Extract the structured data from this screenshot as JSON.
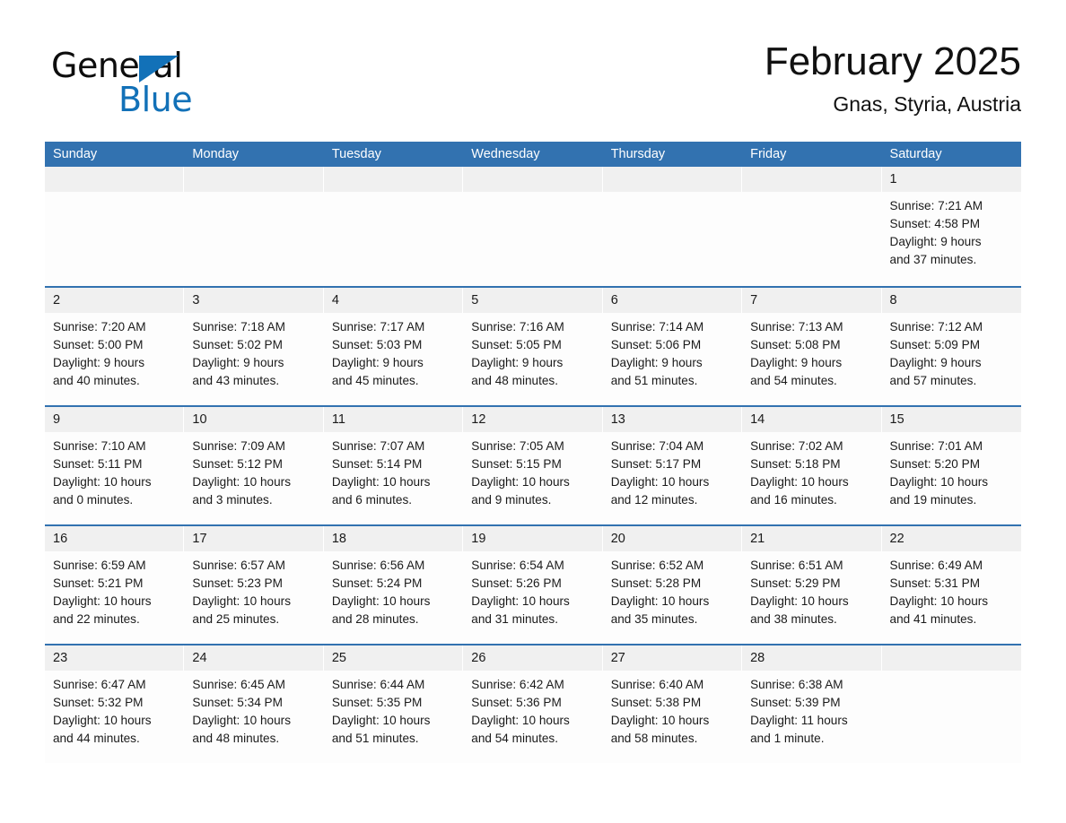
{
  "logo": {
    "word_one": "General",
    "word_two": "Blue",
    "triangle_icon": "blue-triangle-icon",
    "accent_color": "#1271b8"
  },
  "header": {
    "month_title": "February 2025",
    "location": "Gnas, Styria, Austria"
  },
  "colors": {
    "header_blue": "#3272b0",
    "daynum_gray": "#f0f0f0",
    "cell_white": "#fdfdfd",
    "text": "#1a1a1a"
  },
  "calendar": {
    "day_headers": [
      "Sunday",
      "Monday",
      "Tuesday",
      "Wednesday",
      "Thursday",
      "Friday",
      "Saturday"
    ],
    "weeks": [
      [
        {
          "day": "",
          "empty": true
        },
        {
          "day": "",
          "empty": true
        },
        {
          "day": "",
          "empty": true
        },
        {
          "day": "",
          "empty": true
        },
        {
          "day": "",
          "empty": true
        },
        {
          "day": "",
          "empty": true
        },
        {
          "day": "1",
          "sunrise": "Sunrise: 7:21 AM",
          "sunset": "Sunset: 4:58 PM",
          "daylight_1": "Daylight: 9 hours",
          "daylight_2": "and 37 minutes."
        }
      ],
      [
        {
          "day": "2",
          "sunrise": "Sunrise: 7:20 AM",
          "sunset": "Sunset: 5:00 PM",
          "daylight_1": "Daylight: 9 hours",
          "daylight_2": "and 40 minutes."
        },
        {
          "day": "3",
          "sunrise": "Sunrise: 7:18 AM",
          "sunset": "Sunset: 5:02 PM",
          "daylight_1": "Daylight: 9 hours",
          "daylight_2": "and 43 minutes."
        },
        {
          "day": "4",
          "sunrise": "Sunrise: 7:17 AM",
          "sunset": "Sunset: 5:03 PM",
          "daylight_1": "Daylight: 9 hours",
          "daylight_2": "and 45 minutes."
        },
        {
          "day": "5",
          "sunrise": "Sunrise: 7:16 AM",
          "sunset": "Sunset: 5:05 PM",
          "daylight_1": "Daylight: 9 hours",
          "daylight_2": "and 48 minutes."
        },
        {
          "day": "6",
          "sunrise": "Sunrise: 7:14 AM",
          "sunset": "Sunset: 5:06 PM",
          "daylight_1": "Daylight: 9 hours",
          "daylight_2": "and 51 minutes."
        },
        {
          "day": "7",
          "sunrise": "Sunrise: 7:13 AM",
          "sunset": "Sunset: 5:08 PM",
          "daylight_1": "Daylight: 9 hours",
          "daylight_2": "and 54 minutes."
        },
        {
          "day": "8",
          "sunrise": "Sunrise: 7:12 AM",
          "sunset": "Sunset: 5:09 PM",
          "daylight_1": "Daylight: 9 hours",
          "daylight_2": "and 57 minutes."
        }
      ],
      [
        {
          "day": "9",
          "sunrise": "Sunrise: 7:10 AM",
          "sunset": "Sunset: 5:11 PM",
          "daylight_1": "Daylight: 10 hours",
          "daylight_2": "and 0 minutes."
        },
        {
          "day": "10",
          "sunrise": "Sunrise: 7:09 AM",
          "sunset": "Sunset: 5:12 PM",
          "daylight_1": "Daylight: 10 hours",
          "daylight_2": "and 3 minutes."
        },
        {
          "day": "11",
          "sunrise": "Sunrise: 7:07 AM",
          "sunset": "Sunset: 5:14 PM",
          "daylight_1": "Daylight: 10 hours",
          "daylight_2": "and 6 minutes."
        },
        {
          "day": "12",
          "sunrise": "Sunrise: 7:05 AM",
          "sunset": "Sunset: 5:15 PM",
          "daylight_1": "Daylight: 10 hours",
          "daylight_2": "and 9 minutes."
        },
        {
          "day": "13",
          "sunrise": "Sunrise: 7:04 AM",
          "sunset": "Sunset: 5:17 PM",
          "daylight_1": "Daylight: 10 hours",
          "daylight_2": "and 12 minutes."
        },
        {
          "day": "14",
          "sunrise": "Sunrise: 7:02 AM",
          "sunset": "Sunset: 5:18 PM",
          "daylight_1": "Daylight: 10 hours",
          "daylight_2": "and 16 minutes."
        },
        {
          "day": "15",
          "sunrise": "Sunrise: 7:01 AM",
          "sunset": "Sunset: 5:20 PM",
          "daylight_1": "Daylight: 10 hours",
          "daylight_2": "and 19 minutes."
        }
      ],
      [
        {
          "day": "16",
          "sunrise": "Sunrise: 6:59 AM",
          "sunset": "Sunset: 5:21 PM",
          "daylight_1": "Daylight: 10 hours",
          "daylight_2": "and 22 minutes."
        },
        {
          "day": "17",
          "sunrise": "Sunrise: 6:57 AM",
          "sunset": "Sunset: 5:23 PM",
          "daylight_1": "Daylight: 10 hours",
          "daylight_2": "and 25 minutes."
        },
        {
          "day": "18",
          "sunrise": "Sunrise: 6:56 AM",
          "sunset": "Sunset: 5:24 PM",
          "daylight_1": "Daylight: 10 hours",
          "daylight_2": "and 28 minutes."
        },
        {
          "day": "19",
          "sunrise": "Sunrise: 6:54 AM",
          "sunset": "Sunset: 5:26 PM",
          "daylight_1": "Daylight: 10 hours",
          "daylight_2": "and 31 minutes."
        },
        {
          "day": "20",
          "sunrise": "Sunrise: 6:52 AM",
          "sunset": "Sunset: 5:28 PM",
          "daylight_1": "Daylight: 10 hours",
          "daylight_2": "and 35 minutes."
        },
        {
          "day": "21",
          "sunrise": "Sunrise: 6:51 AM",
          "sunset": "Sunset: 5:29 PM",
          "daylight_1": "Daylight: 10 hours",
          "daylight_2": "and 38 minutes."
        },
        {
          "day": "22",
          "sunrise": "Sunrise: 6:49 AM",
          "sunset": "Sunset: 5:31 PM",
          "daylight_1": "Daylight: 10 hours",
          "daylight_2": "and 41 minutes."
        }
      ],
      [
        {
          "day": "23",
          "sunrise": "Sunrise: 6:47 AM",
          "sunset": "Sunset: 5:32 PM",
          "daylight_1": "Daylight: 10 hours",
          "daylight_2": "and 44 minutes."
        },
        {
          "day": "24",
          "sunrise": "Sunrise: 6:45 AM",
          "sunset": "Sunset: 5:34 PM",
          "daylight_1": "Daylight: 10 hours",
          "daylight_2": "and 48 minutes."
        },
        {
          "day": "25",
          "sunrise": "Sunrise: 6:44 AM",
          "sunset": "Sunset: 5:35 PM",
          "daylight_1": "Daylight: 10 hours",
          "daylight_2": "and 51 minutes."
        },
        {
          "day": "26",
          "sunrise": "Sunrise: 6:42 AM",
          "sunset": "Sunset: 5:36 PM",
          "daylight_1": "Daylight: 10 hours",
          "daylight_2": "and 54 minutes."
        },
        {
          "day": "27",
          "sunrise": "Sunrise: 6:40 AM",
          "sunset": "Sunset: 5:38 PM",
          "daylight_1": "Daylight: 10 hours",
          "daylight_2": "and 58 minutes."
        },
        {
          "day": "28",
          "sunrise": "Sunrise: 6:38 AM",
          "sunset": "Sunset: 5:39 PM",
          "daylight_1": "Daylight: 11 hours",
          "daylight_2": "and 1 minute."
        },
        {
          "day": "",
          "empty": true
        }
      ]
    ]
  }
}
